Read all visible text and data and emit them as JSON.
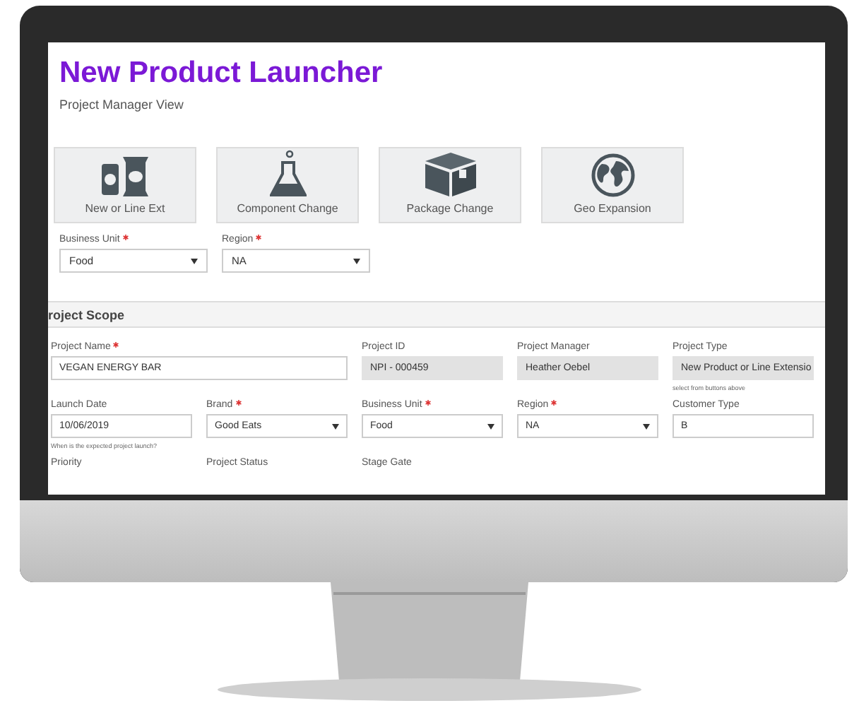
{
  "app": {
    "title": "New Product Launcher",
    "subtitle": "Project Manager View"
  },
  "launch_types": [
    {
      "label": "New or Line Ext",
      "kind": "snacks"
    },
    {
      "label": "Component Change",
      "kind": "flask"
    },
    {
      "label": "Package Change",
      "kind": "box"
    },
    {
      "label": "Geo Expansion",
      "kind": "globe"
    }
  ],
  "filters": [
    {
      "label": "Business Unit",
      "required": true,
      "value": "Food"
    },
    {
      "label": "Region",
      "required": true,
      "value": "NA"
    }
  ],
  "section": {
    "title": "roject Scope"
  },
  "fields": [
    {
      "label": "Project Name",
      "required": true,
      "kind": "text",
      "value": "VEGAN ENERGY BAR"
    },
    {
      "label": "Project ID",
      "required": false,
      "kind": "readonly",
      "value": "NPI - 000459"
    },
    {
      "label": "Project Manager",
      "required": false,
      "kind": "readonly",
      "value": "Heather Oebel"
    },
    {
      "label": "Project Type",
      "required": false,
      "kind": "readonly",
      "value": "New Product or Line Extensio",
      "hint": "select from buttons above"
    },
    {
      "label": "Launch Date",
      "required": false,
      "kind": "text",
      "value": "10/06/2019",
      "hint": "When is the expected project launch?"
    },
    {
      "label": "Brand",
      "required": true,
      "kind": "select",
      "value": "Good Eats"
    },
    {
      "label": "Business Unit",
      "required": true,
      "kind": "select",
      "value": "Food"
    },
    {
      "label": "Region",
      "required": true,
      "kind": "select",
      "value": "NA"
    },
    {
      "label": "Customer Type",
      "required": false,
      "kind": "text",
      "value": "B"
    },
    {
      "label": "Priority",
      "required": false,
      "kind": "label"
    },
    {
      "label": "Project Status",
      "required": false,
      "kind": "label"
    },
    {
      "label": "Stage Gate",
      "required": false,
      "kind": "label"
    }
  ]
}
